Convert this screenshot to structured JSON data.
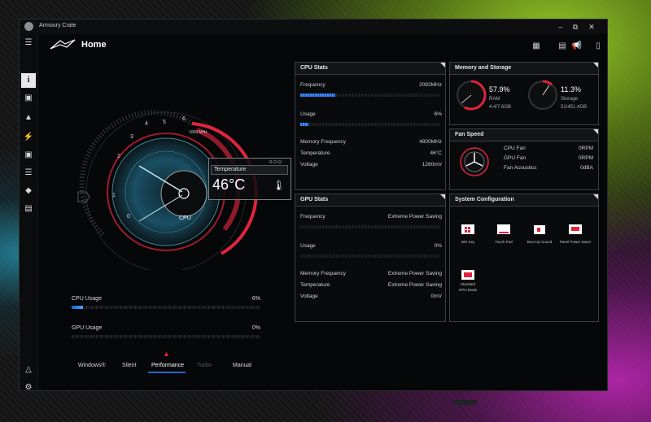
{
  "window": {
    "title": "Armoury Crate"
  },
  "header": {
    "page_title": "Home"
  },
  "gauge": {
    "speed_label": "1000 MHz",
    "ticks": [
      "0",
      "1",
      "2",
      "3",
      "4",
      "5",
      "6"
    ],
    "cpu_label": "CPU",
    "temperature_label": "Temperature",
    "temperature_value": "46°C",
    "tag": "R.O.G/ 2.0.5"
  },
  "usage": {
    "cpu": {
      "label": "CPU Usage",
      "value": "6%",
      "percent": 6
    },
    "gpu": {
      "label": "GPU Usage",
      "value": "0%",
      "percent": 0
    }
  },
  "modes": [
    "Windows®",
    "Silent",
    "Performance",
    "Turbo",
    "Manual"
  ],
  "active_mode": "Performance",
  "cpu_stats": {
    "title": "CPU Stats",
    "frequency_label": "Frequency",
    "frequency_value": "2092MHz",
    "frequency_fill": 0.25,
    "usage_label": "Usage",
    "usage_value": "6%",
    "usage_fill": 0.06,
    "mem_freq_label": "Memory Frequency",
    "mem_freq_value": "4800MHz",
    "temperature_label": "Temperature",
    "temperature_value": "46°C",
    "voltage_label": "Voltage",
    "voltage_value": "1260mV"
  },
  "gpu_stats": {
    "title": "GPU Stats",
    "frequency_label": "Frequency",
    "frequency_value": "Extreme Power Saving",
    "usage_label": "Usage",
    "usage_value": "0%",
    "mem_freq_label": "Memory Frequency",
    "mem_freq_value": "Extreme Power Saving",
    "temperature_label": "Temperature",
    "temperature_value": "Extreme Power Saving",
    "voltage_label": "Voltage",
    "voltage_value": "0mV"
  },
  "memory_storage": {
    "title": "Memory and Storage",
    "ram_percent": "57.9%",
    "ram_label": "RAM",
    "ram_detail": "4.4/7.6GB",
    "ram_fill": 0.579,
    "storage_percent": "11.3%",
    "storage_label": "Storage",
    "storage_detail": "51/451.4GB",
    "storage_fill": 0.113
  },
  "fan_speed": {
    "title": "Fan Speed",
    "cpu_fan_label": "CPU Fan",
    "cpu_fan_value": "0RPM",
    "gpu_fan_label": "GPU Fan",
    "gpu_fan_value": "0RPM",
    "acoustics_label": "Fan Acoustics",
    "acoustics_value": "0dBA"
  },
  "system_config": {
    "title": "System Configuration",
    "tiles": [
      {
        "label": "Win Key"
      },
      {
        "label": "Touch Pad"
      },
      {
        "label": "Boot Up Sound"
      },
      {
        "label": "Panel Power Saver"
      },
      {
        "label": "GPU Mode",
        "badge": "Standard"
      }
    ]
  },
  "colors": {
    "accent_red": "#e0243d",
    "accent_blue": "#3f8cff",
    "cyan": "#5fd3f0"
  }
}
